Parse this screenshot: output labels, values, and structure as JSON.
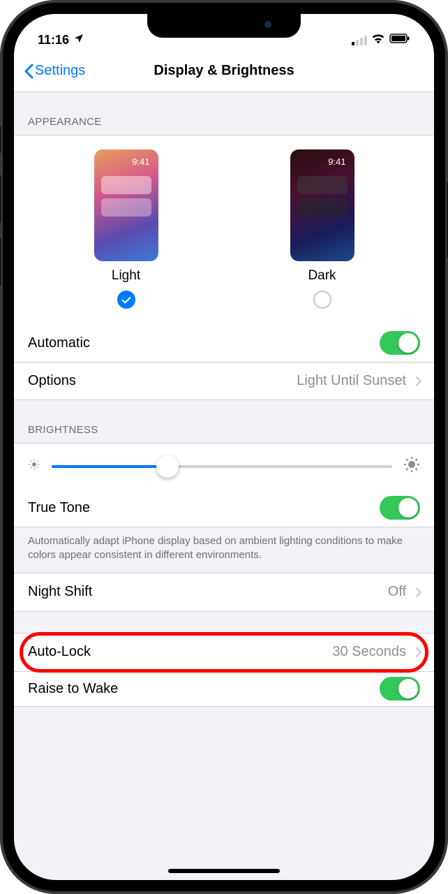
{
  "status": {
    "time": "11:16",
    "location_icon": "location-arrow"
  },
  "nav": {
    "back_label": "Settings",
    "title": "Display & Brightness"
  },
  "appearance": {
    "header": "APPEARANCE",
    "preview_time": "9:41",
    "light_label": "Light",
    "dark_label": "Dark",
    "selected": "light",
    "automatic_label": "Automatic",
    "automatic_on": true,
    "options_label": "Options",
    "options_value": "Light Until Sunset"
  },
  "brightness": {
    "header": "BRIGHTNESS",
    "level": 0.34,
    "true_tone_label": "True Tone",
    "true_tone_on": true,
    "footer": "Automatically adapt iPhone display based on ambient lighting conditions to make colors appear consistent in different environments."
  },
  "night_shift": {
    "label": "Night Shift",
    "value": "Off"
  },
  "auto_lock": {
    "label": "Auto-Lock",
    "value": "30 Seconds"
  },
  "raise_to_wake": {
    "label": "Raise to Wake",
    "on": true
  }
}
